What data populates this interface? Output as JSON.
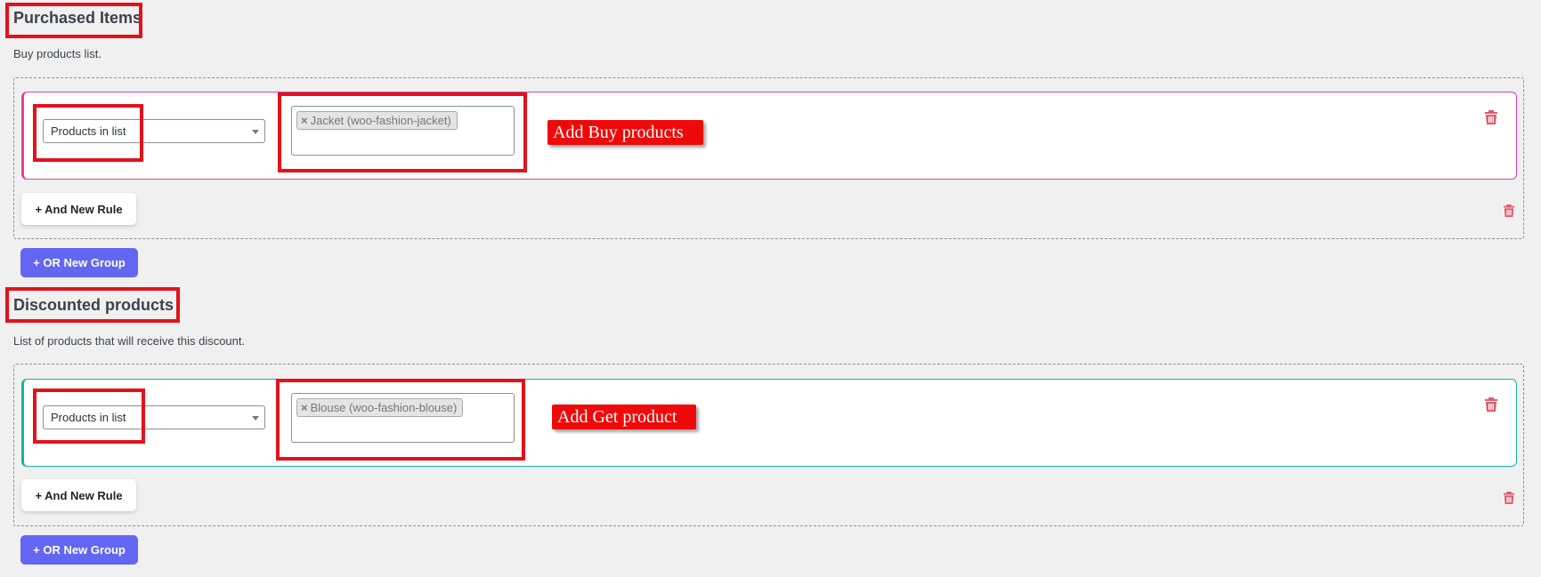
{
  "purchased": {
    "title": "Purchased Items",
    "description": "Buy products list.",
    "condition_select": "Products in list",
    "tags": [
      {
        "remove": "×",
        "label": "Jacket (woo-fashion-jacket)"
      }
    ],
    "annotation": "Add Buy products",
    "and_rule_label": "+ And New Rule",
    "or_group_label": "+ OR New Group"
  },
  "discounted": {
    "title": "Discounted products",
    "description": "List of products that will receive this discount.",
    "condition_select": "Products in list",
    "tags": [
      {
        "remove": "×",
        "label": "Blouse (woo-fashion-blouse)"
      }
    ],
    "annotation": "Add Get product",
    "and_rule_label": "+ And New Rule",
    "or_group_label": "+ OR New Group"
  },
  "colors": {
    "annotation_red": "#e3121b",
    "or_button": "#6366f1",
    "trash_icon": "#e05a6b",
    "purchased_card_border": "#e040a0",
    "discounted_card_border": "#1bb394"
  },
  "icons": {
    "delete_rule": "trash-icon",
    "delete_group": "trash-icon",
    "select_arrow": "caret-down-icon"
  }
}
